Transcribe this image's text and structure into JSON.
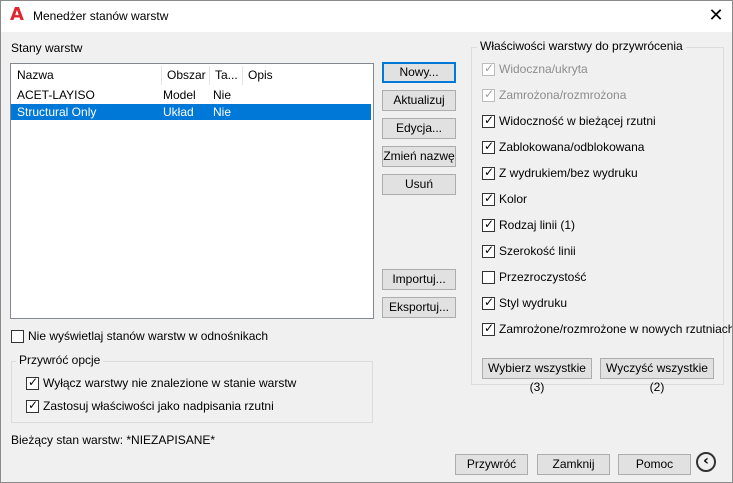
{
  "window": {
    "title": "Menedżer stanów warstw",
    "close_glyph": "✕",
    "app_icon_glyph": "A"
  },
  "states": {
    "label": "Stany warstw",
    "columns": [
      "Nazwa",
      "Obszar",
      "Ta...",
      "Opis"
    ],
    "rows": [
      {
        "name": "ACET-LAYISO",
        "space": "Model",
        "ta": "Nie",
        "desc": "",
        "selected": false
      },
      {
        "name": "Structural Only",
        "space": "Układ",
        "ta": "Nie",
        "desc": "",
        "selected": true
      }
    ]
  },
  "buttons": {
    "new": "Nowy...",
    "update": "Aktualizuj",
    "edit": "Edycja...",
    "rename": "Zmień nazwę",
    "delete": "Usuń",
    "import": "Importuj...",
    "export": "Eksportuj..."
  },
  "xref_option": {
    "label": "Nie wyświetlaj stanów warstw w odnośnikach",
    "checked": false
  },
  "restore_options": {
    "title": "Przywróć opcje",
    "items": [
      {
        "label": "Wyłącz warstwy nie znalezione w stanie warstw",
        "checked": true
      },
      {
        "label": "Zastosuj właściwości jako nadpisania rzutni",
        "checked": true
      }
    ]
  },
  "properties": {
    "title": "Właściwości warstwy do przywrócenia",
    "items": [
      {
        "label": "Widoczna/ukryta",
        "checked": true,
        "disabled": true
      },
      {
        "label": "Zamrożona/rozmrożona",
        "checked": true,
        "disabled": true
      },
      {
        "label": "Widoczność w bieżącej rzutni",
        "checked": true,
        "disabled": false
      },
      {
        "label": "Zablokowana/odblokowana",
        "checked": true,
        "disabled": false
      },
      {
        "label": "Z wydrukiem/bez wydruku",
        "checked": true,
        "disabled": false
      },
      {
        "label": "Kolor",
        "checked": true,
        "disabled": false
      },
      {
        "label": "Rodzaj linii (1)",
        "checked": true,
        "disabled": false
      },
      {
        "label": "Szerokość linii",
        "checked": true,
        "disabled": false
      },
      {
        "label": "Przezroczystość",
        "checked": false,
        "disabled": false
      },
      {
        "label": "Styl wydruku",
        "checked": true,
        "disabled": false
      },
      {
        "label": "Zamrożone/rozmrożone w nowych rzutniach",
        "checked": true,
        "disabled": false
      }
    ],
    "select_all": "Wybierz wszystkie (3)",
    "clear_all": "Wyczyść wszystkie (2)"
  },
  "current_state": "Bieżący stan warstw: *NIEZAPISANE*",
  "footer": {
    "restore": "Przywróć",
    "close": "Zamknij",
    "help": "Pomoc",
    "nav_glyph": "‹"
  }
}
